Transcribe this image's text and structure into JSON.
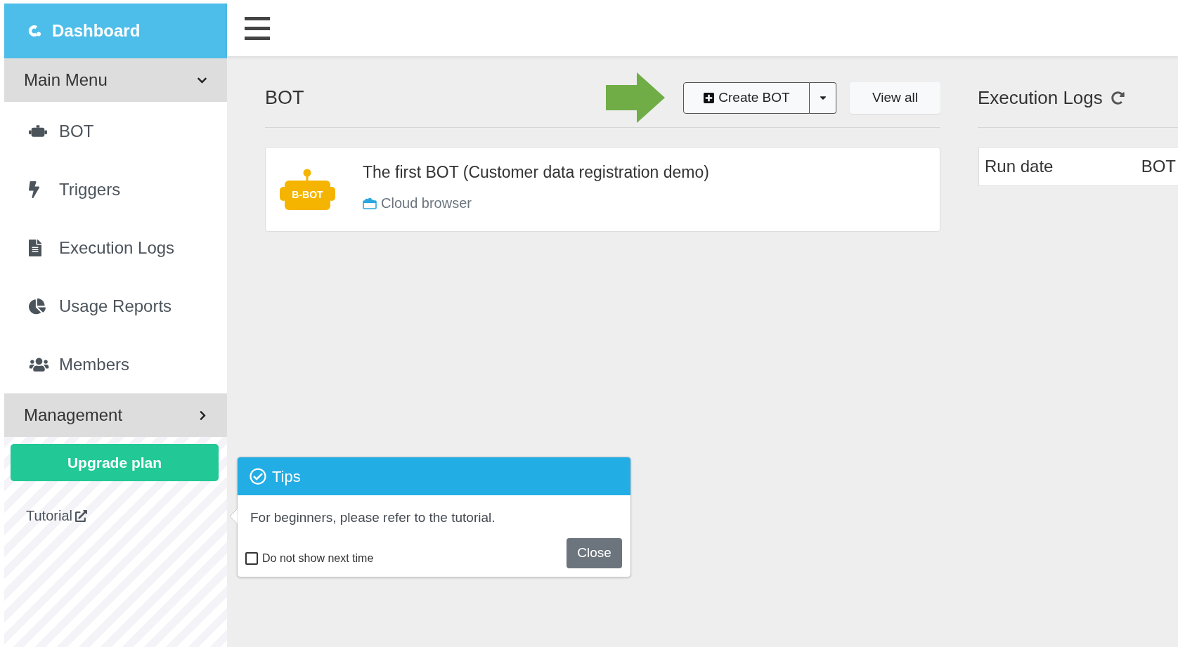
{
  "sidebar": {
    "brand": {
      "label": "Dashboard"
    },
    "sections": [
      {
        "label": "Main Menu",
        "expanded": true,
        "items": [
          {
            "label": "BOT"
          },
          {
            "label": "Triggers"
          },
          {
            "label": "Execution Logs"
          },
          {
            "label": "Usage Reports"
          },
          {
            "label": "Members"
          }
        ]
      },
      {
        "label": "Management",
        "expanded": false
      }
    ],
    "upgrade_button": "Upgrade plan",
    "tutorial_link": "Tutorial"
  },
  "bot_panel": {
    "title": "BOT",
    "create_button": "Create BOT",
    "view_all_button": "View all",
    "bots": [
      {
        "name": "The first BOT (Customer data registration demo)",
        "logo_text": "B-BOT",
        "browser": "Cloud browser"
      }
    ]
  },
  "logs_panel": {
    "title": "Execution Logs",
    "columns": [
      "Run date",
      "BOT"
    ]
  },
  "tips": {
    "title": "Tips",
    "message": "For beginners, please refer to the tutorial.",
    "dont_show_next_time": {
      "label": "Do not show next time",
      "checked": false
    },
    "close_button": "Close"
  }
}
